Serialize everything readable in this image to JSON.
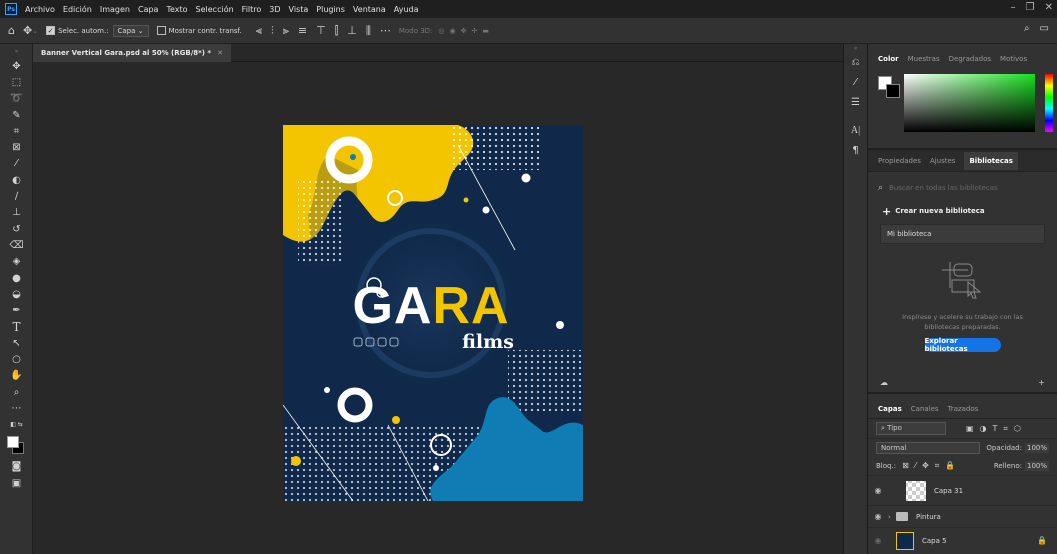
{
  "menubar": {
    "logo": "Ps",
    "items": [
      "Archivo",
      "Edición",
      "Imagen",
      "Capa",
      "Texto",
      "Selección",
      "Filtro",
      "3D",
      "Vista",
      "Plugins",
      "Ventana",
      "Ayuda"
    ]
  },
  "options": {
    "select_auto_label": "Selec. autom.:",
    "layer_select": "Capa",
    "show_transform_label": "Mostrar contr. transf.",
    "mode3d_label": "Modo 3D:"
  },
  "document": {
    "tab_title": "Banner Vertical Gara.psd al 50% (RGB/8*) *"
  },
  "artwork": {
    "logo_text": "GARA",
    "subtitle": "films",
    "colors": {
      "background": "#10294a",
      "yellow": "#f2c500",
      "blue": "#0f7db3",
      "white": "#ffffff"
    }
  },
  "color_panel": {
    "tabs": [
      "Color",
      "Muestras",
      "Degradados",
      "Motivos"
    ]
  },
  "properties_panel": {
    "tabs": [
      "Propiedades",
      "Ajustes",
      "Bibliotecas"
    ],
    "search_placeholder": "Buscar en todas las bibliotecas",
    "create_label": "Crear nueva biblioteca",
    "library_name": "Mi biblioteca",
    "info_text": "Inspírese y acelere su trabajo con las bibliotecas preparadas.",
    "explore_button": "Explorar bibliotecas"
  },
  "layers_panel": {
    "tabs": [
      "Capas",
      "Canales",
      "Trazados"
    ],
    "filter_label": "Tipo",
    "blend_mode": "Normal",
    "opacity_label": "Opacidad:",
    "opacity_value": "100%",
    "lock_label": "Bloq.:",
    "fill_label": "Relleno:",
    "fill_value": "100%",
    "layers": [
      {
        "name": "Capa 31",
        "kind": "layer"
      },
      {
        "name": "Pintura",
        "kind": "group"
      },
      {
        "name": "Capa 5",
        "kind": "layer"
      }
    ]
  }
}
